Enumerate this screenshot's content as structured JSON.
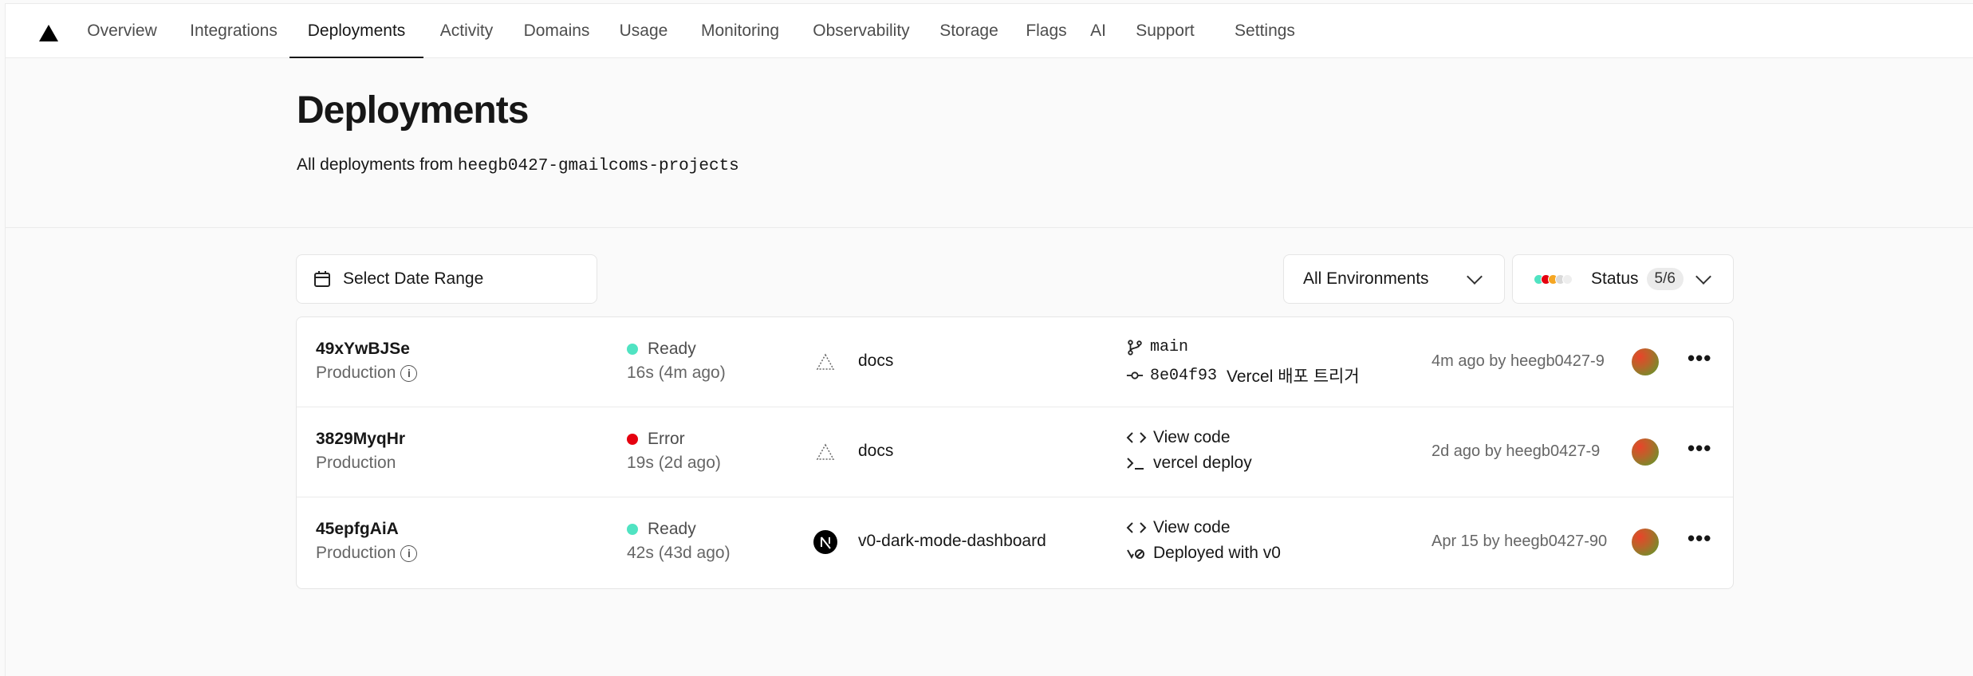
{
  "nav": {
    "tabs": [
      {
        "label": "Overview"
      },
      {
        "label": "Integrations"
      },
      {
        "label": "Deployments",
        "active": true
      },
      {
        "label": "Activity"
      },
      {
        "label": "Domains"
      },
      {
        "label": "Usage"
      },
      {
        "label": "Monitoring"
      },
      {
        "label": "Observability"
      },
      {
        "label": "Storage"
      },
      {
        "label": "Flags"
      },
      {
        "label": "AI"
      },
      {
        "label": "Support"
      },
      {
        "label": "Settings"
      }
    ]
  },
  "header": {
    "title": "Deployments",
    "subtitle_prefix": "All deployments from",
    "project_slug": "heegb0427-gmailcoms-projects"
  },
  "filters": {
    "date_range_label": "Select Date Range",
    "environment_label": "All Environments",
    "status_label": "Status",
    "status_count": "5/6"
  },
  "colors": {
    "ready": "#50e3c2",
    "error": "#e5000f",
    "accent": "#171717"
  },
  "deployments": [
    {
      "id": "49xYwBJSe",
      "environment": "Production",
      "status": "Ready",
      "status_color": "#50e3c2",
      "duration": "16s (4m ago)",
      "project": "docs",
      "project_icon": "vercel-triangle-outline-icon",
      "source_line1": "main",
      "source_line1_icon": "git-branch-icon",
      "commit_hash": "8e04f93",
      "commit_message": "Vercel 배포 트리거",
      "meta": "4m ago by heegb0427-9"
    },
    {
      "id": "3829MyqHr",
      "environment": "Production",
      "status": "Error",
      "status_color": "#e5000f",
      "duration": "19s (2d ago)",
      "project": "docs",
      "project_icon": "vercel-triangle-outline-icon",
      "source_line1": "View code",
      "source_line1_icon": "code-icon",
      "source_line2": "vercel deploy",
      "source_line2_icon": "terminal-icon",
      "meta": "2d ago by heegb0427-9"
    },
    {
      "id": "45epfgAiA",
      "environment": "Production",
      "status": "Ready",
      "status_color": "#50e3c2",
      "duration": "42s (43d ago)",
      "project": "v0-dark-mode-dashboard",
      "project_icon": "nextjs-icon",
      "source_line1": "View code",
      "source_line1_icon": "code-icon",
      "source_line2": "Deployed with v0",
      "source_line2_icon": "v0-icon",
      "meta": "Apr 15 by heegb0427-90"
    }
  ]
}
